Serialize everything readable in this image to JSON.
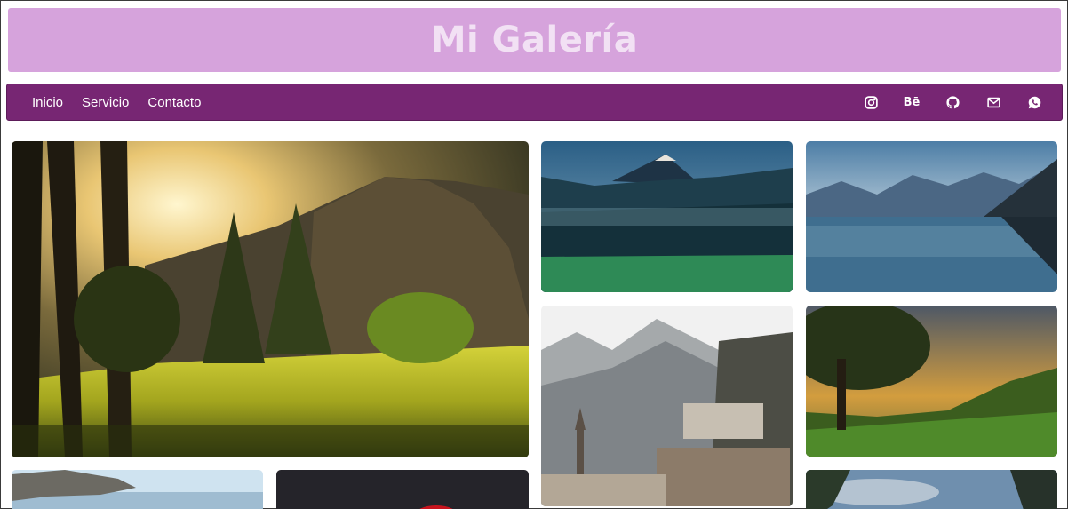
{
  "header": {
    "title": "Mi Galería"
  },
  "nav": {
    "links": [
      "Inicio",
      "Servicio",
      "Contacto"
    ],
    "icons": [
      "instagram-icon",
      "behance-icon",
      "github-icon",
      "mail-icon",
      "whatsapp-icon"
    ],
    "behance_label": "Bē"
  },
  "colors": {
    "banner": "#d6a3dc",
    "banner_text": "#f2e1f4",
    "navbar": "#772673"
  },
  "gallery": {
    "images": [
      "forest-valley-sunrise",
      "volcano-blue-misty-valley",
      "mountain-lake-reflection",
      "snowy-mountain-village",
      "green-hills-sunset-tree",
      "rock-ledge-sky",
      "dark-red-image",
      "blue-sky-partial"
    ]
  }
}
